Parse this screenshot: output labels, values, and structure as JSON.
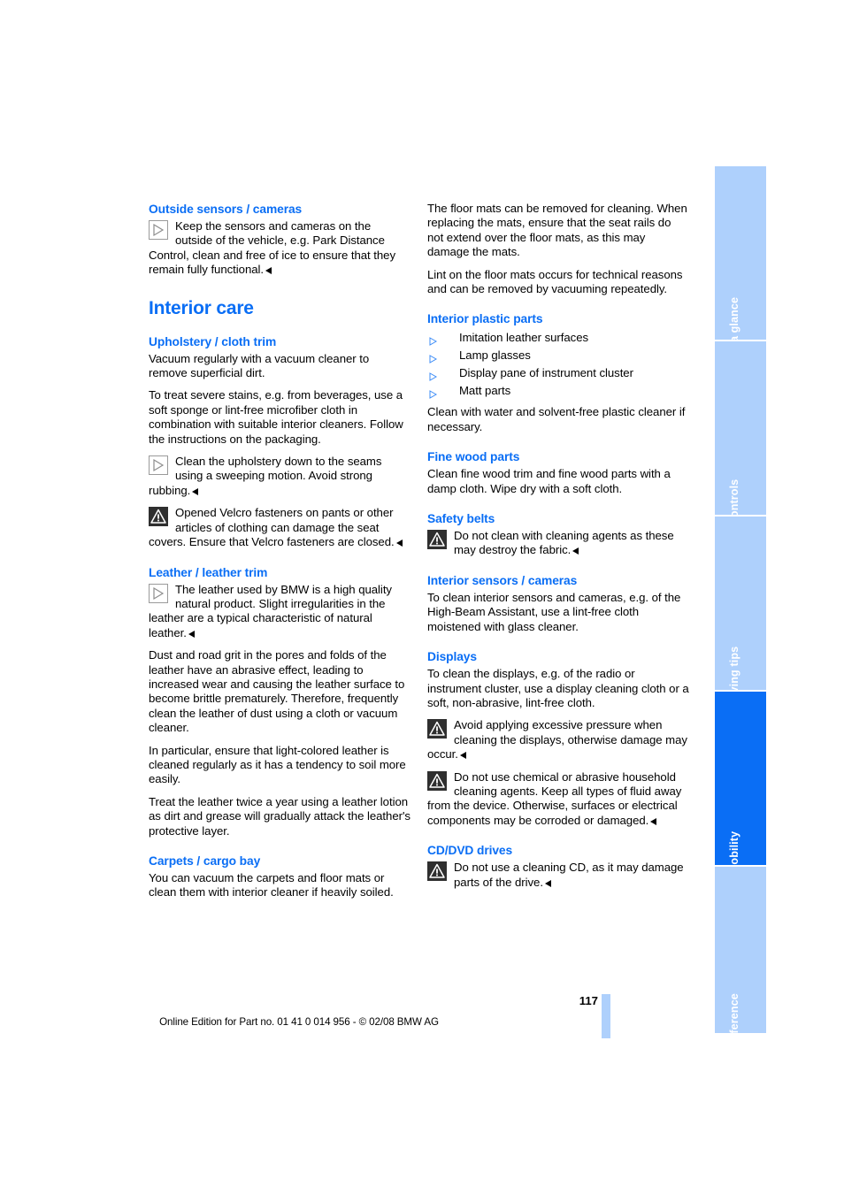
{
  "document": {
    "page_number": "117",
    "imprint": "Online Edition for Part no. 01 41 0 014 956 - © 02/08 BMW AG"
  },
  "colors": {
    "heading_blue": "#0a6ef5",
    "tab_blue": "#aed0fc",
    "tab_active_blue": "#0a6ef5"
  },
  "left_column": {
    "section_outside_sensors": {
      "heading": "Outside sensors / cameras",
      "note": "Keep the sensors and cameras on the outside of the vehicle, e.g. Park Distance Control, clean and free of ice to ensure that they remain fully functional."
    },
    "chapter_title": "Interior care",
    "section_upholstery": {
      "heading": "Upholstery / cloth trim",
      "para1": "Vacuum regularly with a vacuum cleaner to remove superficial dirt.",
      "para2": "To treat severe stains, e.g. from beverages, use a soft sponge or lint-free microfiber cloth in combination with suitable interior cleaners. Follow the instructions on the packaging.",
      "note": "Clean the upholstery down to the seams using a sweeping motion. Avoid strong rubbing.",
      "warning": "Opened Velcro fasteners on pants or other articles of clothing can damage the seat covers. Ensure that Velcro fasteners are closed."
    },
    "section_leather": {
      "heading": "Leather / leather trim",
      "note": "The leather used by BMW is a high quality natural product. Slight irregularities in the leather are a typical characteristic of natural leather.",
      "para1": "Dust and road grit in the pores and folds of the leather have an abrasive effect, leading to increased wear and causing the leather surface to become brittle prematurely. Therefore, frequently clean the leather of dust using a cloth or vacuum cleaner.",
      "para2": "In particular, ensure that light-colored leather is cleaned regularly as it has a tendency to soil more easily.",
      "para3": "Treat the leather twice a year using a leather lotion as dirt and grease will gradually attack the leather's protective layer."
    },
    "section_carpets": {
      "heading": "Carpets / cargo bay",
      "para1": "You can vacuum the carpets and floor mats or clean them with interior cleaner if heavily soiled."
    }
  },
  "right_column": {
    "carpets_continued": {
      "para1": "The floor mats can be removed for cleaning. When replacing the mats, ensure that the seat rails do not extend over the floor mats, as this may damage the mats.",
      "para2": "Lint on the floor mats occurs for technical reasons and can be removed by vacuuming repeatedly."
    },
    "section_plastic": {
      "heading": "Interior plastic parts",
      "items": [
        "Imitation leather surfaces",
        "Lamp glasses",
        "Display pane of instrument cluster",
        "Matt parts"
      ],
      "para1": "Clean with water and solvent-free plastic cleaner if necessary."
    },
    "section_wood": {
      "heading": "Fine wood parts",
      "para1": "Clean fine wood trim and fine wood parts with a damp cloth. Wipe dry with a soft cloth."
    },
    "section_belts": {
      "heading": "Safety belts",
      "warning": "Do not clean with cleaning agents as these may destroy the fabric."
    },
    "section_interior_sensors": {
      "heading": "Interior sensors / cameras",
      "para1": "To clean interior sensors and cameras, e.g. of the High-Beam Assistant, use a lint-free cloth moistened with glass cleaner."
    },
    "section_displays": {
      "heading": "Displays",
      "para1": "To clean the displays, e.g. of the radio or instrument cluster, use a display cleaning cloth or a soft, non-abrasive, lint-free cloth.",
      "warning1": "Avoid applying excessive pressure when cleaning the displays, otherwise damage may occur.",
      "warning2": "Do not use chemical or abrasive household cleaning agents. Keep all types of fluid away from the device. Otherwise, surfaces or electrical components may be corroded or damaged."
    },
    "section_cd_dvd": {
      "heading": "CD/DVD drives",
      "warning": "Do not use a cleaning CD, as it may damage parts of the drive."
    }
  },
  "tabs": [
    {
      "label": "At a glance",
      "active": false
    },
    {
      "label": "Controls",
      "active": false
    },
    {
      "label": "Driving tips",
      "active": false
    },
    {
      "label": "Mobility",
      "active": true
    },
    {
      "label": "Reference",
      "active": false
    }
  ]
}
